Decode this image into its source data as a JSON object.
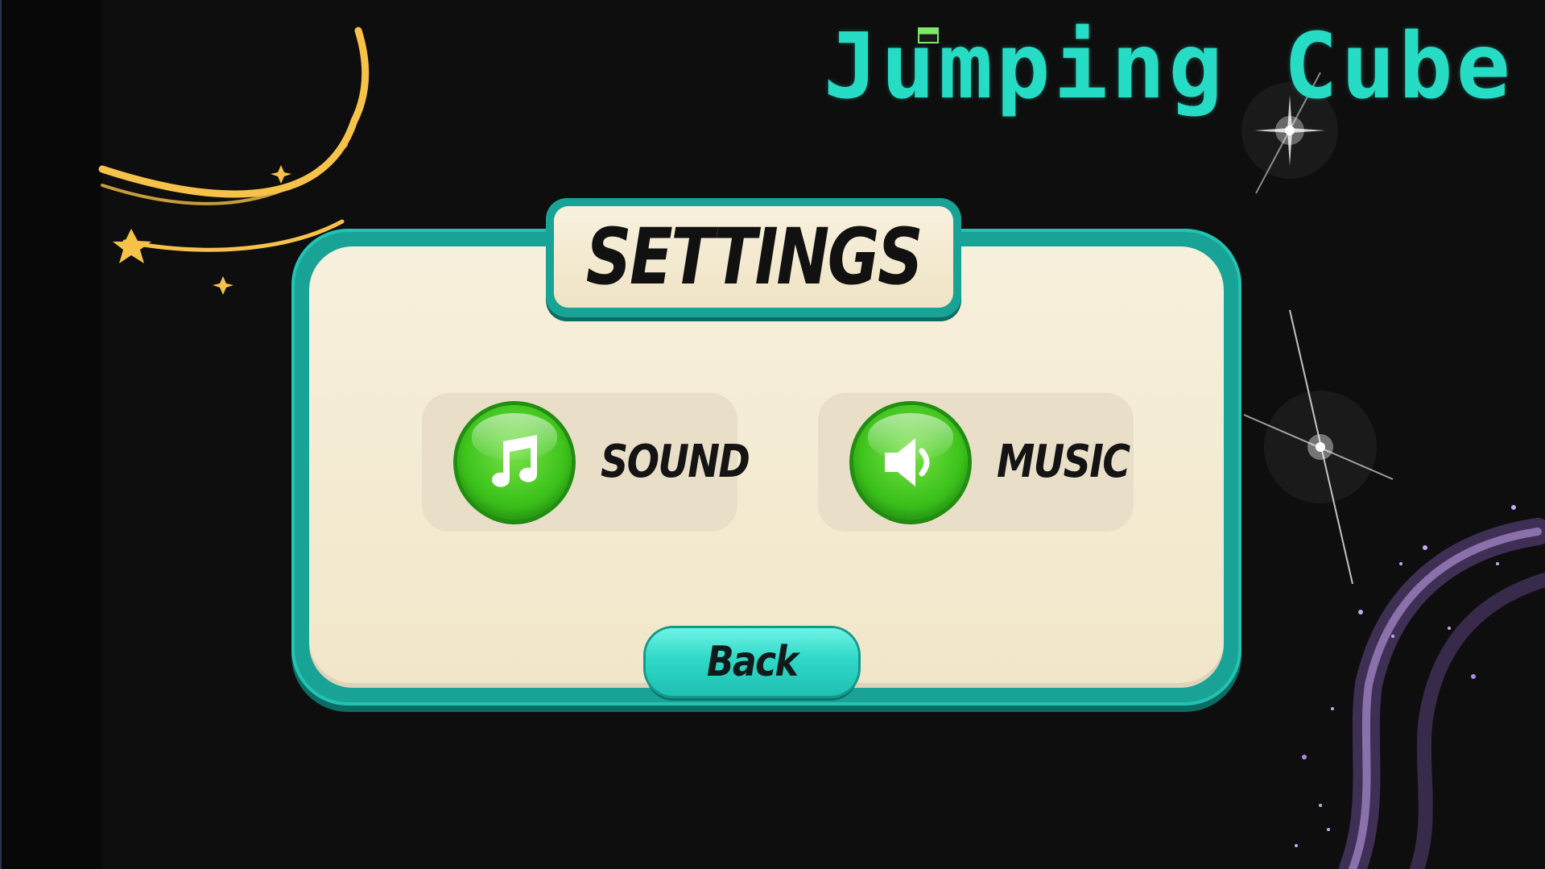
{
  "game": {
    "title": "Jumping Cube"
  },
  "panel": {
    "title": "SETTINGS"
  },
  "options": [
    {
      "label": "SOUND",
      "icon": "music-note-icon"
    },
    {
      "label": "MUSIC",
      "icon": "speaker-icon"
    }
  ],
  "back": {
    "label": "Back"
  },
  "colors": {
    "background": "#0e0e0e",
    "title_teal": "#27dcc5",
    "panel_border": "#18a396",
    "panel_fill": "#f4ebd3",
    "button_green": "#3fc41d",
    "back_button": "#2fd8c8",
    "star_gold": "#f6c24a",
    "sparkle_purple": "#9b6dd6"
  }
}
